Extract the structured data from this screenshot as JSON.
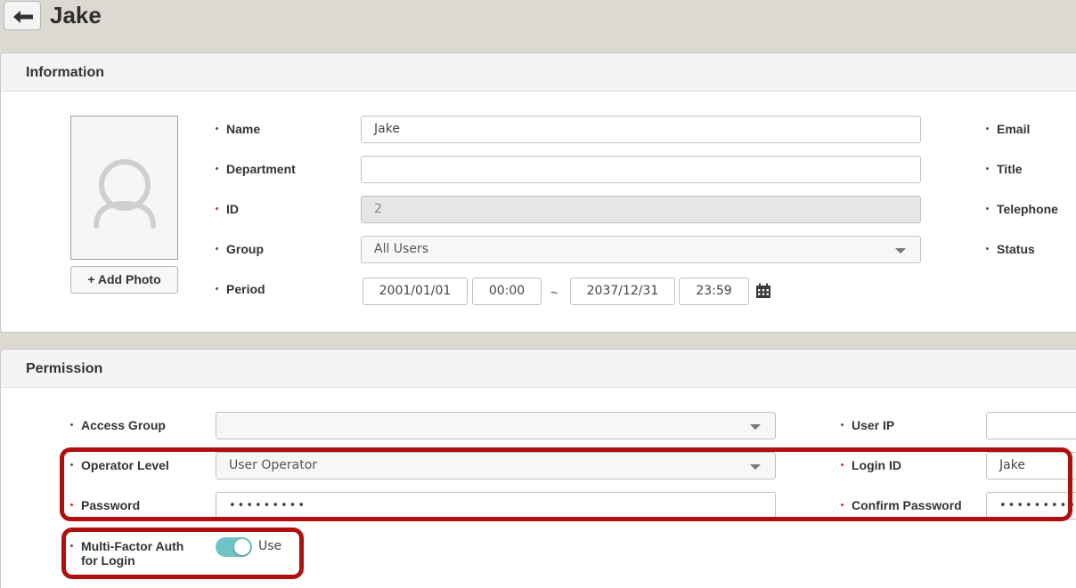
{
  "header": {
    "title": "Jake",
    "back_icon": "arrow-left-icon"
  },
  "information": {
    "title": "Information",
    "add_photo_label": "+ Add Photo",
    "fields": {
      "name": {
        "label": "Name",
        "value": "Jake"
      },
      "department": {
        "label": "Department",
        "value": ""
      },
      "id": {
        "label": "ID",
        "value": "2"
      },
      "group": {
        "label": "Group",
        "value": "All Users"
      },
      "period": {
        "label": "Period",
        "start_date": "2001/01/01",
        "start_time": "00:00",
        "separator": "~",
        "end_date": "2037/12/31",
        "end_time": "23:59"
      },
      "email": {
        "label": "Email"
      },
      "title": {
        "label": "Title"
      },
      "telephone": {
        "label": "Telephone"
      },
      "status": {
        "label": "Status"
      }
    }
  },
  "permission": {
    "title": "Permission",
    "fields": {
      "access_group": {
        "label": "Access Group",
        "value": ""
      },
      "operator_level": {
        "label": "Operator Level",
        "value": "User Operator"
      },
      "password": {
        "label": "Password",
        "value": "•••••••••"
      },
      "mfa": {
        "label_line1": "Multi-Factor Auth",
        "label_line2": "for Login",
        "toggle_label": "Use",
        "enabled": true
      },
      "user_ip": {
        "label": "User IP",
        "value": ""
      },
      "login_id": {
        "label": "Login ID",
        "value": "Jake"
      },
      "confirm_password": {
        "label": "Confirm Password",
        "value": "•••••••••"
      }
    }
  },
  "colors": {
    "required_dot": "#e0311f",
    "toggle_on": "#6ec3c6",
    "highlight": "#b00f10"
  }
}
